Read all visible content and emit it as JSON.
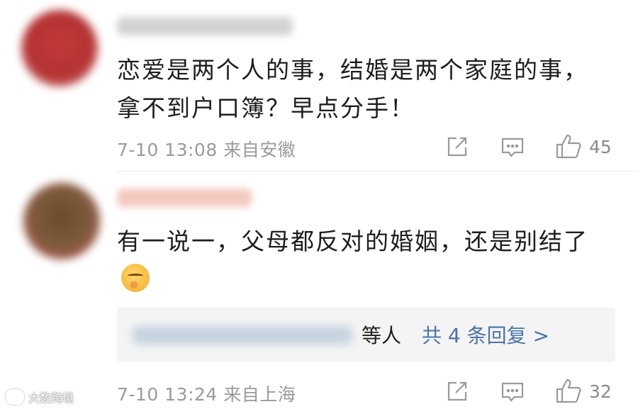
{
  "comments": [
    {
      "text": "恋爱是两个人的事，结婚是两个家庭的事，拿不到户口簿？早点分手！",
      "time": "7-10 13:08",
      "location": "来自安徽",
      "likes": "45",
      "icons": {
        "share": "share-icon",
        "reply": "comment-icon",
        "like": "thumbs-up-icon"
      }
    },
    {
      "text": "有一说一，父母都反对的婚姻，还是别结了",
      "emoji": "shushing-face-emoji",
      "replies": {
        "etc_label": "等人",
        "link_label": "共 4 条回复 >"
      },
      "time": "7-10 13:24",
      "location": "来自上海",
      "likes": "32",
      "icons": {
        "share": "share-icon",
        "reply": "comment-icon",
        "like": "thumbs-up-icon"
      }
    }
  ],
  "watermark": {
    "text": "大数跨境"
  },
  "colors": {
    "meta_gray": "#9a9a9a",
    "link_blue": "#4a73a8",
    "reply_bg": "#f4f4f4"
  }
}
